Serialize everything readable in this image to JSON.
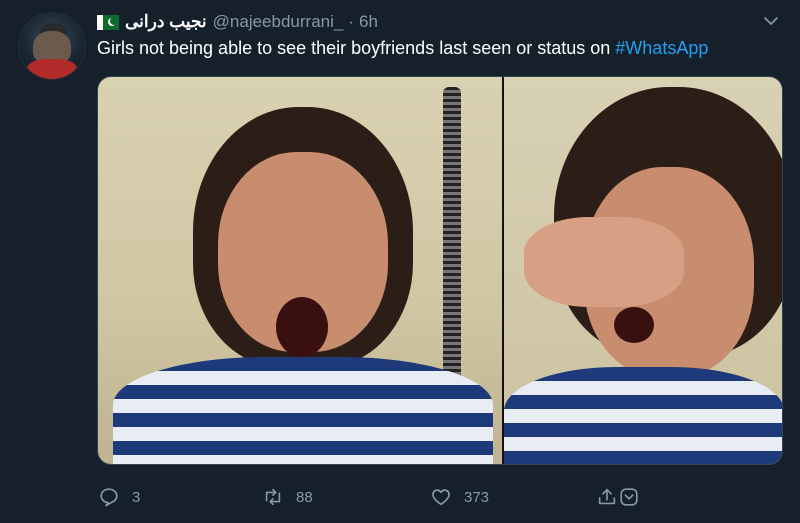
{
  "tweet": {
    "author": {
      "display_name": "نجیب درانی",
      "handle": "@najeebdurrani_",
      "flag_icon": "pakistan-flag-icon",
      "avatar_icon": "avatar"
    },
    "separator": "·",
    "time": "6h",
    "text_prefix": "Girls not being able to see their boyfriends last seen or status on ",
    "hashtag": "#WhatsApp",
    "media": {
      "icons": [
        "photo-crying-girl-screaming",
        "photo-crying-girl-covering-eyes"
      ]
    },
    "actions": {
      "reply": {
        "icon": "reply-icon",
        "count": "3"
      },
      "retweet": {
        "icon": "retweet-icon",
        "count": "88"
      },
      "like": {
        "icon": "heart-icon",
        "count": "373"
      },
      "share": {
        "icon": "share-icon"
      },
      "dm": {
        "icon": "dm-icon"
      }
    },
    "menu_icon": "chevron-down-icon"
  },
  "colors": {
    "background": "#15202b",
    "text_primary": "#ffffff",
    "text_secondary": "#8899a6",
    "accent": "#1da1f2",
    "border": "#38444d"
  }
}
